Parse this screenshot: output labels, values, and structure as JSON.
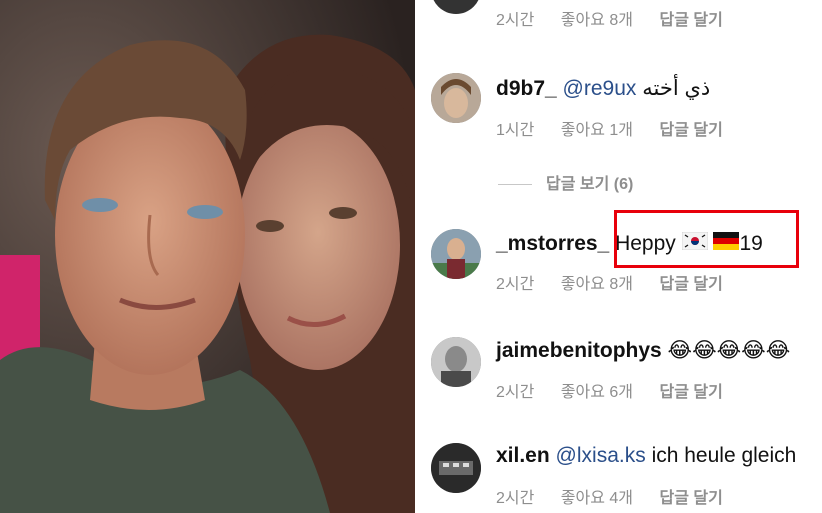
{
  "photo": {
    "description_icon": "photo"
  },
  "comments": [
    {
      "id": "top",
      "username": "",
      "mention": "",
      "text": "",
      "time": "2시간",
      "likes": "좋아요 8개",
      "reply": "답글 달기"
    },
    {
      "id": "d9b7",
      "username": "d9b7_",
      "mention": "@re9ux",
      "text": "ذي أخته",
      "time": "1시간",
      "likes": "좋아요 1개",
      "reply": "답글 달기"
    },
    {
      "id": "mstorres",
      "username": "_mstorres_",
      "mention": "",
      "text": "Heppy",
      "suffix": "19",
      "flags": [
        "korea-flag-icon",
        "germany-flag-icon"
      ],
      "time": "2시간",
      "likes": "좋아요 8개",
      "reply": "답글 달기"
    },
    {
      "id": "jaime",
      "username": "jaimebenitophys",
      "mention": "",
      "text": "😂😂😂😂😂",
      "time": "2시간",
      "likes": "좋아요 6개",
      "reply": "답글 달기"
    },
    {
      "id": "xil",
      "username": "xil.en",
      "mention": "@lxisa.ks",
      "text": "ich heule gleich",
      "time": "2시간",
      "likes": "좋아요 4개",
      "reply": "답글 달기"
    }
  ],
  "view_replies": "답글 보기 (6)",
  "colors": {
    "highlight": "#e8000b",
    "mention": "#2b4f8a",
    "meta": "#8e8e8e"
  }
}
